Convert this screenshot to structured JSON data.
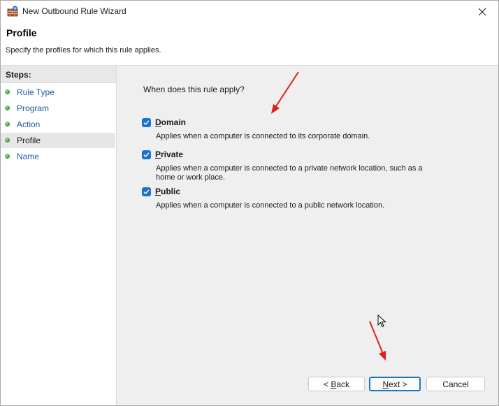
{
  "window": {
    "title": "New Outbound Rule Wizard",
    "close_glyph": "✕"
  },
  "header": {
    "title": "Profile",
    "description": "Specify the profiles for which this rule applies."
  },
  "sidebar": {
    "heading": "Steps:",
    "items": [
      {
        "label": "Rule Type",
        "active": false
      },
      {
        "label": "Program",
        "active": false
      },
      {
        "label": "Action",
        "active": false
      },
      {
        "label": "Profile",
        "active": true
      },
      {
        "label": "Name",
        "active": false
      }
    ]
  },
  "content": {
    "question": "When does this rule apply?",
    "options": [
      {
        "accel": "D",
        "rest": "omain",
        "checked": true,
        "description": "Applies when a computer is connected to its corporate domain."
      },
      {
        "accel": "P",
        "rest": "rivate",
        "checked": true,
        "description": "Applies when a computer is connected to a private network location, such as a home or work place."
      },
      {
        "accel": "P",
        "rest": "ublic",
        "checked": true,
        "pre": "",
        "accel_is_second": true,
        "description": "Applies when a computer is connected to a public network location."
      }
    ]
  },
  "buttons": {
    "back": {
      "pre": "< ",
      "accel": "B",
      "rest": "ack"
    },
    "next": {
      "pre": "",
      "accel": "N",
      "rest": "ext >"
    },
    "cancel": {
      "label": "Cancel"
    }
  },
  "colors": {
    "accent": "#1a73c8",
    "annotation_arrow": "#e0201b",
    "step_link": "#1f5aa0"
  },
  "icons": {
    "app": "firewall-wall-icon",
    "close": "close-icon",
    "step_bullet": "green-dot-icon",
    "checkbox": "checkmark-icon",
    "cursor": "mouse-pointer-icon"
  }
}
